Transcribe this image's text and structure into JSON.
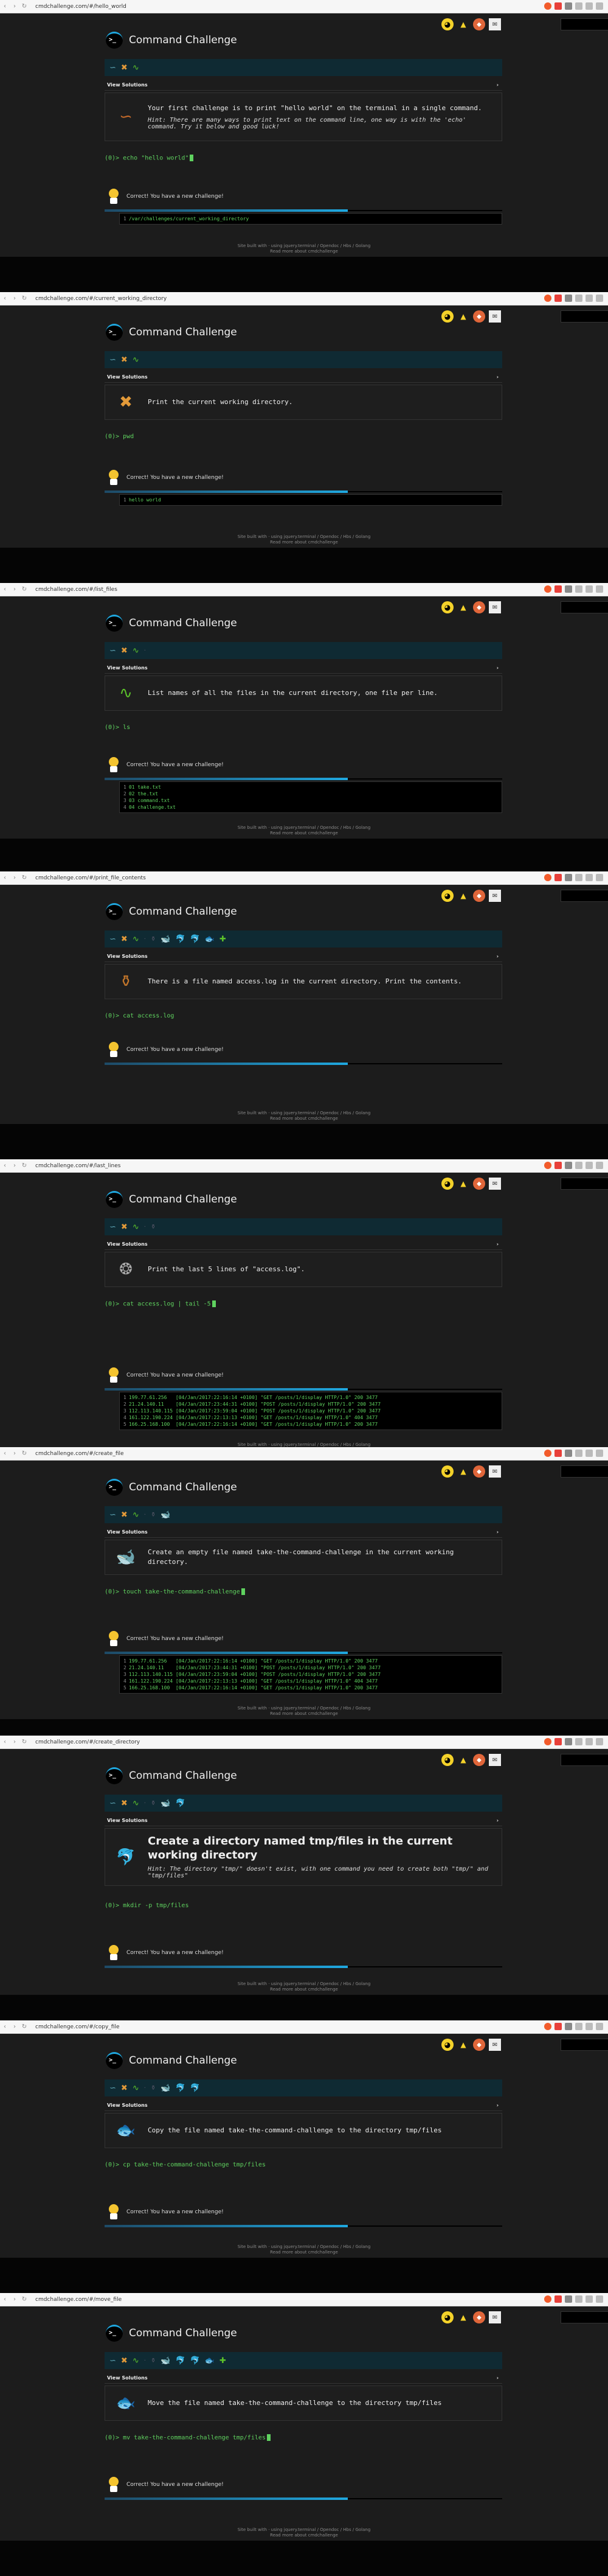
{
  "app_title": "Command Challenge",
  "view_solutions": "View Solutions",
  "correct_msg": "Correct! You have a new challenge!",
  "footer1": "Site built with · using jquery.terminal / Opendoc / Hbs / Golang",
  "footer2": "Read more about cmdchallenge",
  "frames": [
    {
      "url": "cmdchallenge.com/#/hello_world",
      "task": "Your first challenge is to print \"hello world\" on the terminal in a single command.",
      "hint": "Hint: There are many ways to print text on the command line, one way is with the 'echo' command. Try it below and good luck!",
      "cmd": "(0)> echo \"hello world\"",
      "out": [
        "/var/challenges/current_working_directory"
      ]
    },
    {
      "url": "cmdchallenge.com/#/current_working_directory",
      "task": "Print the current working directory.",
      "cmd": "(0)> pwd",
      "out": [
        "hello world"
      ]
    },
    {
      "url": "cmdchallenge.com/#/list_files",
      "task": "List names of all the files in the current directory, one file per line.",
      "cmd": "(0)> ls",
      "out": [
        "01 take.txt",
        "02 the.txt",
        "03 command.txt",
        "04 challenge.txt"
      ]
    },
    {
      "url": "cmdchallenge.com/#/print_file_contents",
      "task": "There is a file named access.log in the current directory. Print the contents.",
      "cmd": "(0)> cat access.log",
      "out": []
    },
    {
      "url": "cmdchallenge.com/#/last_lines",
      "task": "Print the last 5 lines of \"access.log\".",
      "cmd": "(0)> cat access.log | tail -5",
      "out": [
        "199.77.61.256   [04/Jan/2017:22:16:14 +0100] \"GET /posts/1/display HTTP/1.0\" 200 3477",
        "21.24.140.11    [04/Jan/2017:23:44:31 +0100] \"POST /posts/1/display HTTP/1.0\" 200 3477",
        "112.113.140.115 [04/Jan/2017:23:59:04 +0100] \"POST /posts/1/display HTTP/1.0\" 200 3477",
        "161.122.190.224 [04/Jan/2017:22:13:13 +0100] \"GET /posts/1/display HTTP/1.0\" 404 3477",
        "166.25.168.100  [04/Jan/2017:22:16:14 +0100] \"GET /posts/1/display HTTP/1.0\" 200 3477"
      ]
    },
    {
      "url": "cmdchallenge.com/#/create_file",
      "task": "Create an empty file named take-the-command-challenge in the current working directory.",
      "cmd": "(0)> touch take-the-command-challenge",
      "out": [
        "199.77.61.256   [04/Jan/2017:22:16:14 +0100] \"GET /posts/1/display HTTP/1.0\" 200 3477",
        "21.24.140.11    [04/Jan/2017:23:44:31 +0100] \"POST /posts/1/display HTTP/1.0\" 200 3477",
        "112.113.140.115 [04/Jan/2017:23:59:04 +0100] \"POST /posts/1/display HTTP/1.0\" 200 3477",
        "161.122.190.224 [04/Jan/2017:22:13:13 +0100] \"GET /posts/1/display HTTP/1.0\" 404 3477",
        "166.25.168.100  [04/Jan/2017:22:16:14 +0100] \"GET /posts/1/display HTTP/1.0\" 200 3477"
      ]
    },
    {
      "url": "cmdchallenge.com/#/create_directory",
      "task": "Create a directory named tmp/files in the current working directory",
      "hint": "Hint: The directory \"tmp/\" doesn't exist, with one command you need to create both \"tmp/\" and \"tmp/files\"",
      "cmd": "(0)> mkdir -p tmp/files",
      "out": []
    },
    {
      "url": "cmdchallenge.com/#/copy_file",
      "task": "Copy the file named take-the-command-challenge to the directory tmp/files",
      "cmd": "(0)> cp take-the-command-challenge tmp/files",
      "out": []
    },
    {
      "url": "cmdchallenge.com/#/move_file",
      "task": "Move the file named take-the-command-challenge to the directory tmp/files",
      "cmd": "(0)> mv take-the-command-challenge tmp/files",
      "out": []
    }
  ]
}
